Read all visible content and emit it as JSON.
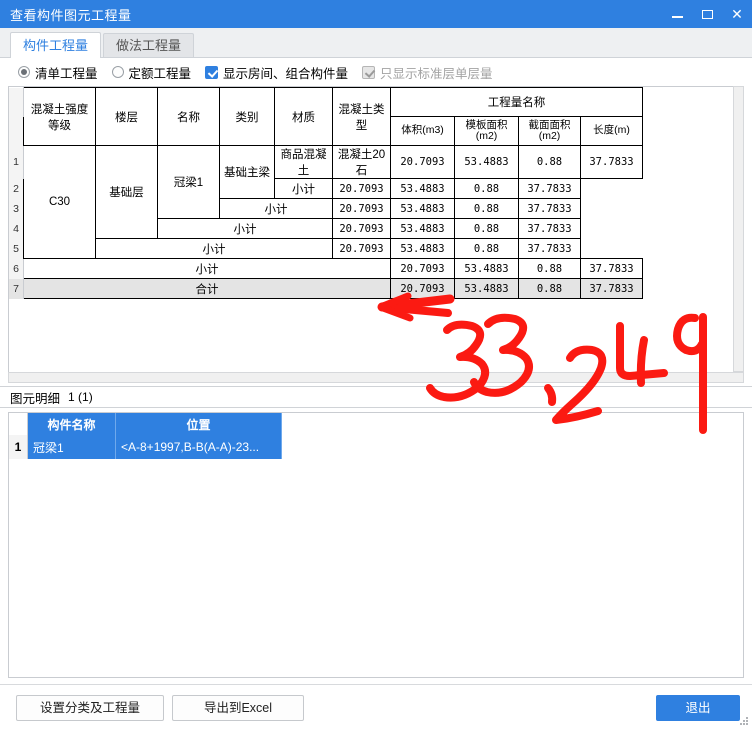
{
  "window": {
    "title": "查看构件图元工程量",
    "minimize_label": "minimize",
    "maximize_label": "maximize",
    "close_label": "✕"
  },
  "tabs": [
    {
      "label": "构件工程量",
      "active": true
    },
    {
      "label": "做法工程量",
      "active": false
    }
  ],
  "options": {
    "radio_list": "清单工程量",
    "radio_norm": "定额工程量",
    "check_room": "显示房间、组合构件量",
    "check_standard": "只显示标准层单层量"
  },
  "grid": {
    "group_header": "工程量名称",
    "columns": [
      "混凝土强度等级",
      "楼层",
      "名称",
      "类别",
      "材质",
      "混凝土类型"
    ],
    "qty_columns": [
      "体积(m3)",
      "模板面积(m2)",
      "截面面积(m2)",
      "长度(m)"
    ],
    "subtotal_label": "小计",
    "total_label": "合计",
    "values": {
      "volume": "20.7093",
      "formwork": "53.4883",
      "section": "0.88",
      "length": "37.7833"
    },
    "row1": {
      "grade": "C30",
      "floor": "基础层",
      "name": "冠梁1",
      "category": "基础主梁",
      "material": "商品混凝土",
      "concrete_type": "混凝土20石"
    },
    "row_numbers": [
      "1",
      "2",
      "3",
      "4",
      "5",
      "6",
      "7"
    ]
  },
  "detail": {
    "title": "图元明细",
    "count": "1 (1)",
    "columns": [
      "构件名称",
      "位置"
    ],
    "rows": [
      {
        "num": "1",
        "name": "冠梁1",
        "position": "<A-8+1997,B-B(A-A)-23..."
      }
    ]
  },
  "footer": {
    "set_class_button": "设置分类及工程量",
    "export_button": "导出到Excel",
    "exit_button": "退出"
  },
  "annotation": {
    "text": "33.249",
    "color": "#fb1a12",
    "arrow": "left-arrow"
  }
}
